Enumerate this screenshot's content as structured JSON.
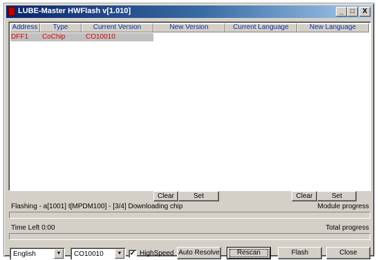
{
  "window": {
    "title": "LUBE-Master HWFlash v[1.010]",
    "controls": {
      "minimize": "_",
      "maximize": "□",
      "close": "X"
    }
  },
  "table": {
    "columns": [
      "Address",
      "Type",
      "Current Version",
      "New Version",
      "Current Language",
      "New Language"
    ],
    "rows": [
      {
        "address": "DFF1",
        "type": "CoChip",
        "current_version": "CO10010"
      }
    ]
  },
  "buttons": {
    "clear_left": "Clear",
    "set_left": "Set",
    "clear_right": "Clear",
    "set_right": "Set",
    "auto_resolve": "Auto Resolve",
    "rescan": "Rescan",
    "flash": "Flash",
    "close": "Close"
  },
  "status": {
    "flashing": "Flashing - a[1001] t[MPDM100] - [3/4] Downloading chip",
    "module_progress_label": "Module progress",
    "time_left": "Time Left 0:00",
    "total_progress_label": "Total progress"
  },
  "controls": {
    "language": "English",
    "version": "CO10010",
    "highspeed_label": "HighSpeed",
    "highspeed_checked": true
  },
  "colors": {
    "title_start": "#0a246a",
    "title_end": "#a6caf0",
    "row_text": "#e00000",
    "header_text": "#1030a0"
  }
}
